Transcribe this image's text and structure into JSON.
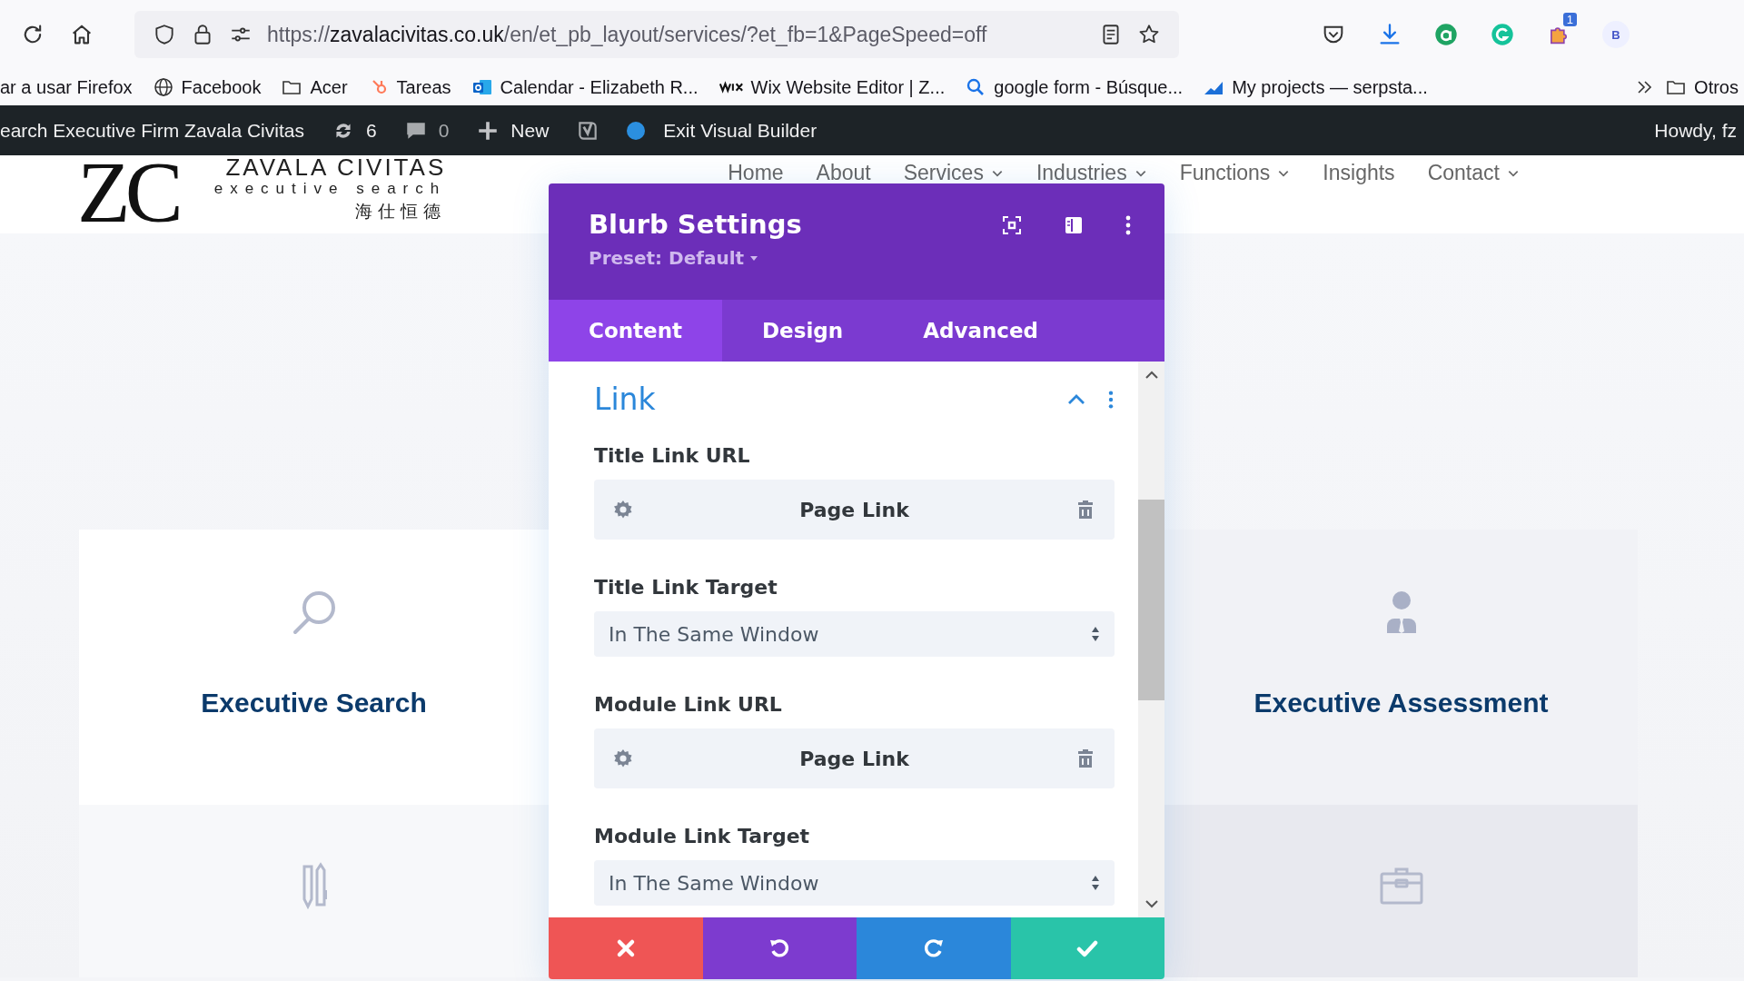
{
  "browser": {
    "url": {
      "scheme": "https://",
      "host": "zavalacivitas.co.uk",
      "path": "/en/et_pb_layout/services/?et_fb=1&PageSpeed=off"
    },
    "extension_badge": "1",
    "profile": "B"
  },
  "bookmarks": [
    {
      "label": "ar a usar Firefox",
      "kind": "none"
    },
    {
      "label": "Facebook",
      "kind": "globe"
    },
    {
      "label": "Acer",
      "kind": "folder"
    },
    {
      "label": "Tareas",
      "kind": "hubspot"
    },
    {
      "label": "Calendar - Elizabeth R...",
      "kind": "outlook"
    },
    {
      "label": "Wix Website Editor | Z...",
      "kind": "wix"
    },
    {
      "label": "google form - Búsque...",
      "kind": "search"
    },
    {
      "label": "My projects — serpsta...",
      "kind": "chart"
    }
  ],
  "other_bookmarks": "Otros",
  "admin_bar": {
    "site": "earch Executive Firm Zavala Civitas",
    "updates": "6",
    "comments": "0",
    "new": "New",
    "exit": "Exit Visual Builder",
    "howdy": "Howdy, fz"
  },
  "site_header": {
    "logo": {
      "mark": "ZC",
      "name": "ZAVALA CIVITAS",
      "tagline": "executive search",
      "chinese": "海仕恒德"
    },
    "nav": [
      {
        "label": "Home",
        "dropdown": false
      },
      {
        "label": "About",
        "dropdown": false
      },
      {
        "label": "Services",
        "dropdown": true
      },
      {
        "label": "Industries",
        "dropdown": true
      },
      {
        "label": "Functions",
        "dropdown": true
      },
      {
        "label": "Insights",
        "dropdown": false
      },
      {
        "label": "Contact",
        "dropdown": true
      }
    ]
  },
  "cards": [
    {
      "kind": "search",
      "title": "Executive Search"
    },
    {
      "kind": "assessment",
      "title": "Executive Assessment"
    },
    {
      "kind": "writing"
    },
    {
      "kind": "career"
    }
  ],
  "panel": {
    "title": "Blurb Settings",
    "preset": "Preset: Default",
    "tabs": [
      {
        "label": "Content",
        "selected": true
      },
      {
        "label": "Design",
        "selected": false
      },
      {
        "label": "Advanced",
        "selected": false
      }
    ],
    "section": {
      "title": "Link",
      "expanded": true
    },
    "fields": [
      {
        "kind": "link",
        "label": "Title Link URL",
        "value": "Page Link"
      },
      {
        "kind": "select",
        "label": "Title Link Target",
        "value": "In The Same Window"
      },
      {
        "kind": "link",
        "label": "Module Link URL",
        "value": "Page Link"
      },
      {
        "kind": "select",
        "label": "Module Link Target",
        "value": "In The Same Window"
      }
    ],
    "actions": [
      {
        "kind": "discard"
      },
      {
        "kind": "undo"
      },
      {
        "kind": "redo"
      },
      {
        "kind": "save"
      }
    ]
  }
}
